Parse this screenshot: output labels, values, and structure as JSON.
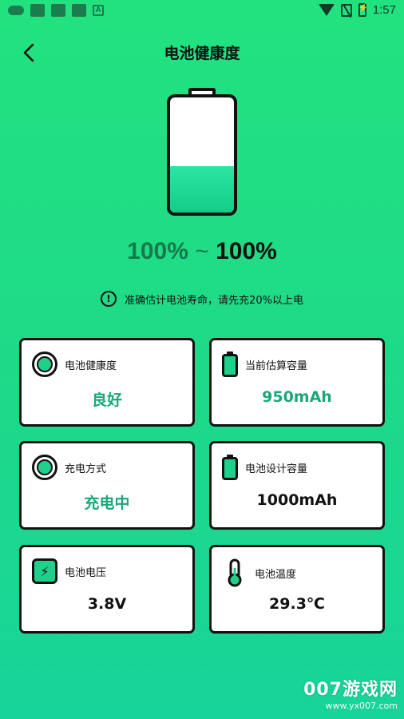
{
  "status_bar": {
    "time": "1:57",
    "left_icons": [
      "game-icon",
      "app-icon",
      "app-icon",
      "image-icon",
      "font-icon"
    ],
    "right_icons": [
      "wifi-icon",
      "no-sim-icon",
      "battery-charging-icon"
    ]
  },
  "header": {
    "title": "电池健康度",
    "back_icon": "chevron-left-icon"
  },
  "battery": {
    "fill_percent": 40,
    "range_low": "100%",
    "range_sep": " ~ ",
    "range_high": "100%"
  },
  "notice": {
    "icon": "exclamation-circle-icon",
    "text": "准确估计电池寿命，请先充20%以上电"
  },
  "cards": [
    {
      "label": "电池健康度",
      "value": "良好",
      "icon": "health-ring-icon",
      "value_color": "#1aa876"
    },
    {
      "label": "当前估算容量",
      "value": "950mAh",
      "icon": "battery-icon",
      "value_color": "#1aa876"
    },
    {
      "label": "充电方式",
      "value": "充电中",
      "icon": "charge-ring-icon",
      "value_color": "#1aa876"
    },
    {
      "label": "电池设计容量",
      "value": "1000mAh",
      "icon": "battery-icon",
      "value_color": "#111111"
    },
    {
      "label": "电池电压",
      "value": "3.8V",
      "icon": "voltage-icon",
      "value_color": "#111111"
    },
    {
      "label": "电池温度",
      "value": "29.3℃",
      "icon": "thermometer-icon",
      "value_color": "#111111"
    }
  ],
  "watermark": {
    "main": "007游戏网",
    "url": "www.yx007.com"
  },
  "colors": {
    "background_top": "#22e27f",
    "background_bottom": "#17d49a",
    "accent": "#1fd08a",
    "value_green": "#1aa876"
  }
}
